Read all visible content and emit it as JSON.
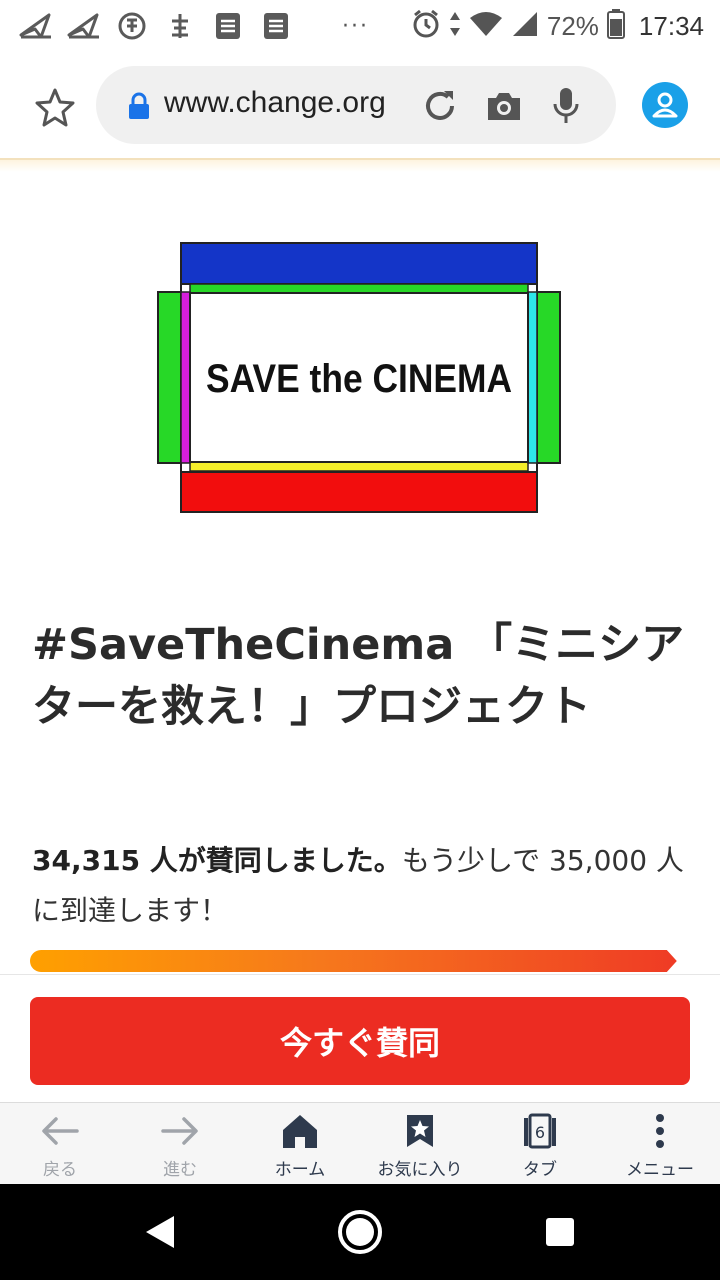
{
  "status_bar": {
    "battery_percent": "72%",
    "time": "17:34",
    "overflow_dots": "···"
  },
  "address_bar": {
    "url": "www.change.org"
  },
  "logo": {
    "text": "SAVE the CINEMA",
    "colors": {
      "top": "#1435c8",
      "bottom": "#f20d0d",
      "left": "#27d827",
      "right": "#27d827",
      "left_inner": "#d71edc",
      "right_inner": "#2ee6ea",
      "top_inner": "#27d827",
      "bottom_inner": "#f5ef2a"
    }
  },
  "petition": {
    "title": "#SaveTheCinema 「ミニシアターを救え！」プロジェクト",
    "signature_count": "34,315 人が賛同しました。",
    "goal_text": "もう少しで 35,000 人に到達します！",
    "progress_fraction": 0.98
  },
  "cta": {
    "sign_label": "今すぐ賛同"
  },
  "toolbar": {
    "items": [
      {
        "label": "戻る",
        "icon": "back-arrow-icon"
      },
      {
        "label": "進む",
        "icon": "forward-arrow-icon"
      },
      {
        "label": "ホーム",
        "icon": "home-icon"
      },
      {
        "label": "お気に入り",
        "icon": "bookmark-icon"
      },
      {
        "label": "タブ",
        "icon": "tabs-icon",
        "badge": "6"
      },
      {
        "label": "メニュー",
        "icon": "more-vert-icon"
      }
    ]
  },
  "colors": {
    "accent": "#ec2c22",
    "avatar": "#1aa0e8",
    "toolbar_icon": "#2e3a4d"
  }
}
